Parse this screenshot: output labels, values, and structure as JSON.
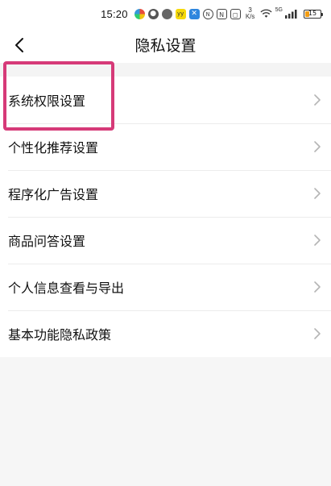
{
  "status_bar": {
    "time": "15:20",
    "net_speed_value": "3",
    "net_speed_unit": "K/s",
    "network_type": "5G",
    "battery_level": "15"
  },
  "header": {
    "title": "隐私设置"
  },
  "settings_list": [
    {
      "label": "系统权限设置"
    },
    {
      "label": "个性化推荐设置"
    },
    {
      "label": "程序化广告设置"
    },
    {
      "label": "商品问答设置"
    },
    {
      "label": "个人信息查看与导出"
    },
    {
      "label": "基本功能隐私政策"
    }
  ],
  "colors": {
    "highlight": "#d63a78",
    "background": "#f6f6f6",
    "card": "#ffffff",
    "chevron": "#b5b5b5"
  },
  "icons": {
    "back": "chevron-left-icon",
    "row_arrow": "chevron-right-icon"
  }
}
